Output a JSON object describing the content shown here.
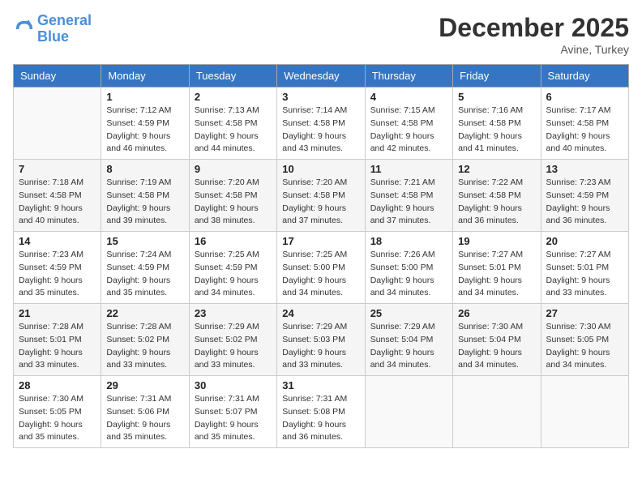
{
  "header": {
    "logo_line1": "General",
    "logo_line2": "Blue",
    "month_year": "December 2025",
    "location": "Avine, Turkey"
  },
  "weekdays": [
    "Sunday",
    "Monday",
    "Tuesday",
    "Wednesday",
    "Thursday",
    "Friday",
    "Saturday"
  ],
  "weeks": [
    [
      {
        "day": "",
        "sunrise": "",
        "sunset": "",
        "daylight": ""
      },
      {
        "day": "1",
        "sunrise": "7:12 AM",
        "sunset": "4:59 PM",
        "daylight": "9 hours and 46 minutes."
      },
      {
        "day": "2",
        "sunrise": "7:13 AM",
        "sunset": "4:58 PM",
        "daylight": "9 hours and 44 minutes."
      },
      {
        "day": "3",
        "sunrise": "7:14 AM",
        "sunset": "4:58 PM",
        "daylight": "9 hours and 43 minutes."
      },
      {
        "day": "4",
        "sunrise": "7:15 AM",
        "sunset": "4:58 PM",
        "daylight": "9 hours and 42 minutes."
      },
      {
        "day": "5",
        "sunrise": "7:16 AM",
        "sunset": "4:58 PM",
        "daylight": "9 hours and 41 minutes."
      },
      {
        "day": "6",
        "sunrise": "7:17 AM",
        "sunset": "4:58 PM",
        "daylight": "9 hours and 40 minutes."
      }
    ],
    [
      {
        "day": "7",
        "sunrise": "7:18 AM",
        "sunset": "4:58 PM",
        "daylight": "9 hours and 40 minutes."
      },
      {
        "day": "8",
        "sunrise": "7:19 AM",
        "sunset": "4:58 PM",
        "daylight": "9 hours and 39 minutes."
      },
      {
        "day": "9",
        "sunrise": "7:20 AM",
        "sunset": "4:58 PM",
        "daylight": "9 hours and 38 minutes."
      },
      {
        "day": "10",
        "sunrise": "7:20 AM",
        "sunset": "4:58 PM",
        "daylight": "9 hours and 37 minutes."
      },
      {
        "day": "11",
        "sunrise": "7:21 AM",
        "sunset": "4:58 PM",
        "daylight": "9 hours and 37 minutes."
      },
      {
        "day": "12",
        "sunrise": "7:22 AM",
        "sunset": "4:58 PM",
        "daylight": "9 hours and 36 minutes."
      },
      {
        "day": "13",
        "sunrise": "7:23 AM",
        "sunset": "4:59 PM",
        "daylight": "9 hours and 36 minutes."
      }
    ],
    [
      {
        "day": "14",
        "sunrise": "7:23 AM",
        "sunset": "4:59 PM",
        "daylight": "9 hours and 35 minutes."
      },
      {
        "day": "15",
        "sunrise": "7:24 AM",
        "sunset": "4:59 PM",
        "daylight": "9 hours and 35 minutes."
      },
      {
        "day": "16",
        "sunrise": "7:25 AM",
        "sunset": "4:59 PM",
        "daylight": "9 hours and 34 minutes."
      },
      {
        "day": "17",
        "sunrise": "7:25 AM",
        "sunset": "5:00 PM",
        "daylight": "9 hours and 34 minutes."
      },
      {
        "day": "18",
        "sunrise": "7:26 AM",
        "sunset": "5:00 PM",
        "daylight": "9 hours and 34 minutes."
      },
      {
        "day": "19",
        "sunrise": "7:27 AM",
        "sunset": "5:01 PM",
        "daylight": "9 hours and 34 minutes."
      },
      {
        "day": "20",
        "sunrise": "7:27 AM",
        "sunset": "5:01 PM",
        "daylight": "9 hours and 33 minutes."
      }
    ],
    [
      {
        "day": "21",
        "sunrise": "7:28 AM",
        "sunset": "5:01 PM",
        "daylight": "9 hours and 33 minutes."
      },
      {
        "day": "22",
        "sunrise": "7:28 AM",
        "sunset": "5:02 PM",
        "daylight": "9 hours and 33 minutes."
      },
      {
        "day": "23",
        "sunrise": "7:29 AM",
        "sunset": "5:02 PM",
        "daylight": "9 hours and 33 minutes."
      },
      {
        "day": "24",
        "sunrise": "7:29 AM",
        "sunset": "5:03 PM",
        "daylight": "9 hours and 33 minutes."
      },
      {
        "day": "25",
        "sunrise": "7:29 AM",
        "sunset": "5:04 PM",
        "daylight": "9 hours and 34 minutes."
      },
      {
        "day": "26",
        "sunrise": "7:30 AM",
        "sunset": "5:04 PM",
        "daylight": "9 hours and 34 minutes."
      },
      {
        "day": "27",
        "sunrise": "7:30 AM",
        "sunset": "5:05 PM",
        "daylight": "9 hours and 34 minutes."
      }
    ],
    [
      {
        "day": "28",
        "sunrise": "7:30 AM",
        "sunset": "5:05 PM",
        "daylight": "9 hours and 35 minutes."
      },
      {
        "day": "29",
        "sunrise": "7:31 AM",
        "sunset": "5:06 PM",
        "daylight": "9 hours and 35 minutes."
      },
      {
        "day": "30",
        "sunrise": "7:31 AM",
        "sunset": "5:07 PM",
        "daylight": "9 hours and 35 minutes."
      },
      {
        "day": "31",
        "sunrise": "7:31 AM",
        "sunset": "5:08 PM",
        "daylight": "9 hours and 36 minutes."
      },
      {
        "day": "",
        "sunrise": "",
        "sunset": "",
        "daylight": ""
      },
      {
        "day": "",
        "sunrise": "",
        "sunset": "",
        "daylight": ""
      },
      {
        "day": "",
        "sunrise": "",
        "sunset": "",
        "daylight": ""
      }
    ]
  ],
  "labels": {
    "sunrise": "Sunrise:",
    "sunset": "Sunset:",
    "daylight": "Daylight:"
  }
}
